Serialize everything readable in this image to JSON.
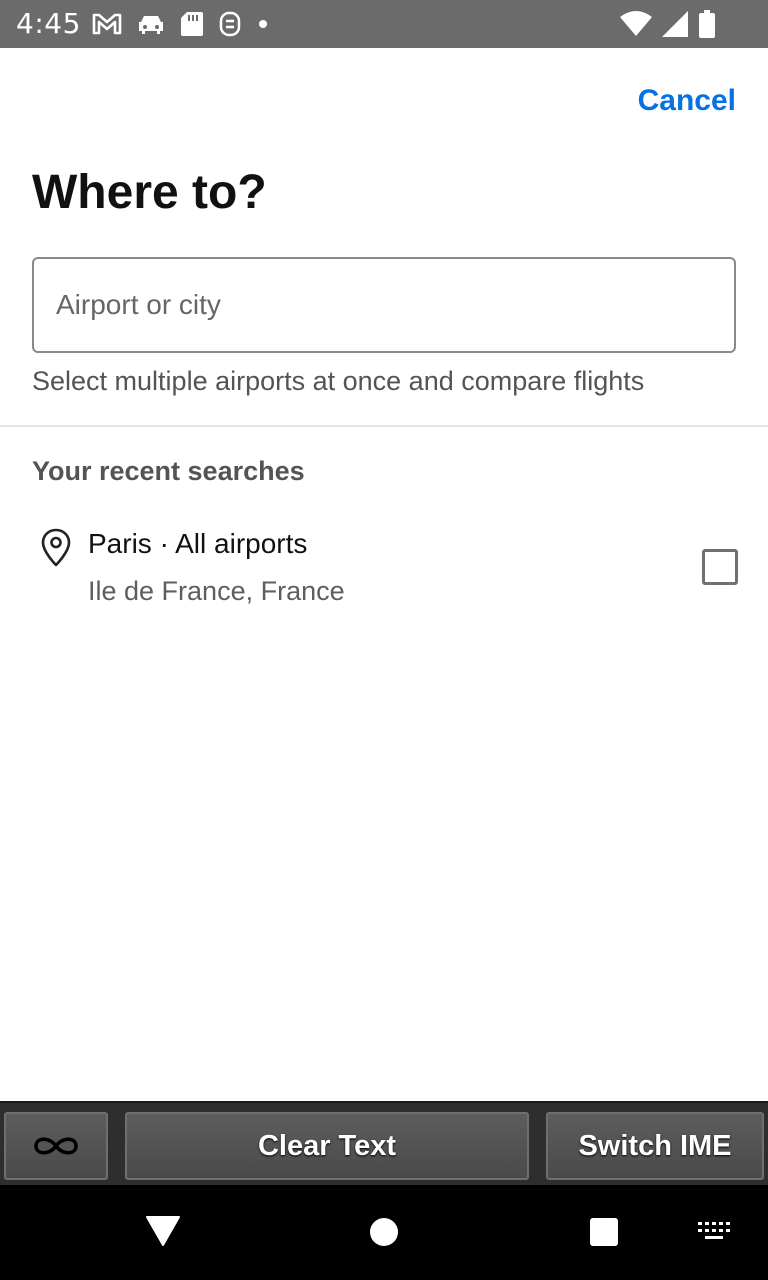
{
  "status_bar": {
    "time": "4:45",
    "left_icons": [
      "gmail-icon",
      "car-icon",
      "sd-card-icon",
      "sync-icon",
      "notification-dot-icon"
    ],
    "right_icons": [
      "wifi-icon",
      "cell-signal-icon",
      "battery-icon"
    ]
  },
  "header": {
    "cancel_label": "Cancel",
    "title": "Where to?"
  },
  "search": {
    "placeholder": "Airport or city",
    "value": "",
    "helper": "Select multiple airports at once and compare flights"
  },
  "recent": {
    "section_title": "Your recent searches",
    "items": [
      {
        "title": "Paris · All airports",
        "subtitle": "Ile de France, France",
        "icon": "location-pin-icon",
        "checked": false
      }
    ]
  },
  "ime_bar": {
    "infinity_icon": "infinity-icon",
    "clear_label": "Clear Text",
    "switch_label": "Switch IME"
  },
  "nav_bar": {
    "icons": [
      "back-icon",
      "home-icon",
      "recents-icon",
      "keyboard-icon"
    ]
  },
  "colors": {
    "accent": "#0770e3",
    "status_bar": "#6b6b6b",
    "text_primary": "#111111",
    "text_secondary": "#545454"
  }
}
